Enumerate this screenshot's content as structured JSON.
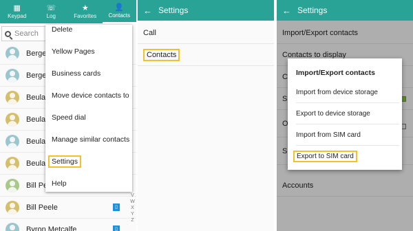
{
  "panel1": {
    "tabs": [
      {
        "label": "Keypad",
        "icon": "keypad-icon"
      },
      {
        "label": "Log",
        "icon": "phone-log-icon"
      },
      {
        "label": "Favorites",
        "icon": "star-icon"
      },
      {
        "label": "Contacts",
        "icon": "person-icon"
      }
    ],
    "search_placeholder": "Search",
    "contacts": [
      {
        "name": "Berger",
        "avatar_color": "#9cc6cf"
      },
      {
        "name": "Berger",
        "avatar_color": "#9cc6cf"
      },
      {
        "name": "Beulah",
        "avatar_color": "#d6bf6b"
      },
      {
        "name": "Beulah",
        "avatar_color": "#d6bf6b"
      },
      {
        "name": "Beulah",
        "avatar_color": "#9cc6cf"
      },
      {
        "name": "Beulah",
        "avatar_color": "#d6bf6b"
      },
      {
        "name": "Bill Pe",
        "avatar_color": "#a8c98a"
      },
      {
        "name": "Bill Peele",
        "avatar_color": "#d6bf6b"
      },
      {
        "name": "Byron Metcalfe",
        "avatar_color": "#9cc6cf"
      }
    ],
    "index_letters": [
      "V",
      "W",
      "X",
      "Y",
      "Z"
    ],
    "menu": [
      {
        "label": "Delete"
      },
      {
        "label": "Yellow Pages"
      },
      {
        "label": "Business cards"
      },
      {
        "label": "Move device contacts to"
      },
      {
        "label": "Speed dial"
      },
      {
        "label": "Manage similar contacts"
      },
      {
        "label": "Settings"
      },
      {
        "label": "Help"
      }
    ]
  },
  "panel2": {
    "title": "Settings",
    "rows": [
      {
        "label": "Call"
      },
      {
        "label": "Contacts"
      }
    ]
  },
  "panel3": {
    "title": "Settings",
    "rows": [
      {
        "label": "Import/Export contacts"
      },
      {
        "label": "Contacts to display"
      },
      {
        "label": "C"
      },
      {
        "label": "S"
      },
      {
        "label": "O"
      },
      {
        "label": "S"
      },
      {
        "label": "Accounts"
      }
    ],
    "dialog": {
      "title": "Import/Export contacts",
      "options": [
        {
          "label": "Import from device storage"
        },
        {
          "label": "Export to device storage"
        },
        {
          "label": "Import from SIM card"
        },
        {
          "label": "Export to SIM card"
        }
      ]
    }
  },
  "colors": {
    "accent": "#2aa397",
    "highlight": "#f2c12e",
    "sim_badge": "#1f8fd6"
  }
}
